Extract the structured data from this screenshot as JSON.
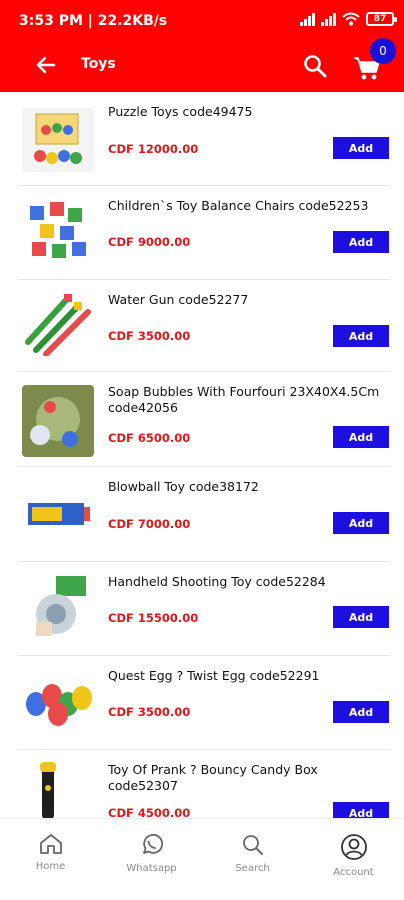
{
  "status_bar": {
    "time_speed": "3:53 PM | 22.2KB/s",
    "battery": "87"
  },
  "app_bar": {
    "title": "Toys",
    "cart_count": "0"
  },
  "products": [
    {
      "name": "Puzzle Toys code49475",
      "price": "CDF 12000.00",
      "add_label": "Add"
    },
    {
      "name": "Children`s Toy Balance Chairs code52253",
      "price": "CDF 9000.00",
      "add_label": "Add"
    },
    {
      "name": "Water Gun code52277",
      "price": "CDF 3500.00",
      "add_label": "Add"
    },
    {
      "name": "Soap Bubbles With Fourfouri 23X40X4.5Cm code42056",
      "price": "CDF 6500.00",
      "add_label": "Add"
    },
    {
      "name": "Blowball Toy code38172",
      "price": "CDF 7000.00",
      "add_label": "Add"
    },
    {
      "name": "Handheld Shooting Toy code52284",
      "price": "CDF 15500.00",
      "add_label": "Add"
    },
    {
      "name": "Quest Egg ? Twist Egg code52291",
      "price": "CDF 3500.00",
      "add_label": "Add"
    },
    {
      "name": "Toy Of Prank ? Bouncy Candy Box code52307",
      "price": "CDF 4500.00",
      "add_label": "Add"
    }
  ],
  "bottom_nav": [
    {
      "label": "Home",
      "icon": "home-icon"
    },
    {
      "label": "Whatsapp",
      "icon": "whatsapp-icon"
    },
    {
      "label": "Search",
      "icon": "search-icon"
    },
    {
      "label": "Account",
      "icon": "account-icon"
    }
  ],
  "colors": {
    "header": "#ff0000",
    "price": "#e11717",
    "button": "#1d0fe0",
    "badge": "#1a10d8"
  }
}
